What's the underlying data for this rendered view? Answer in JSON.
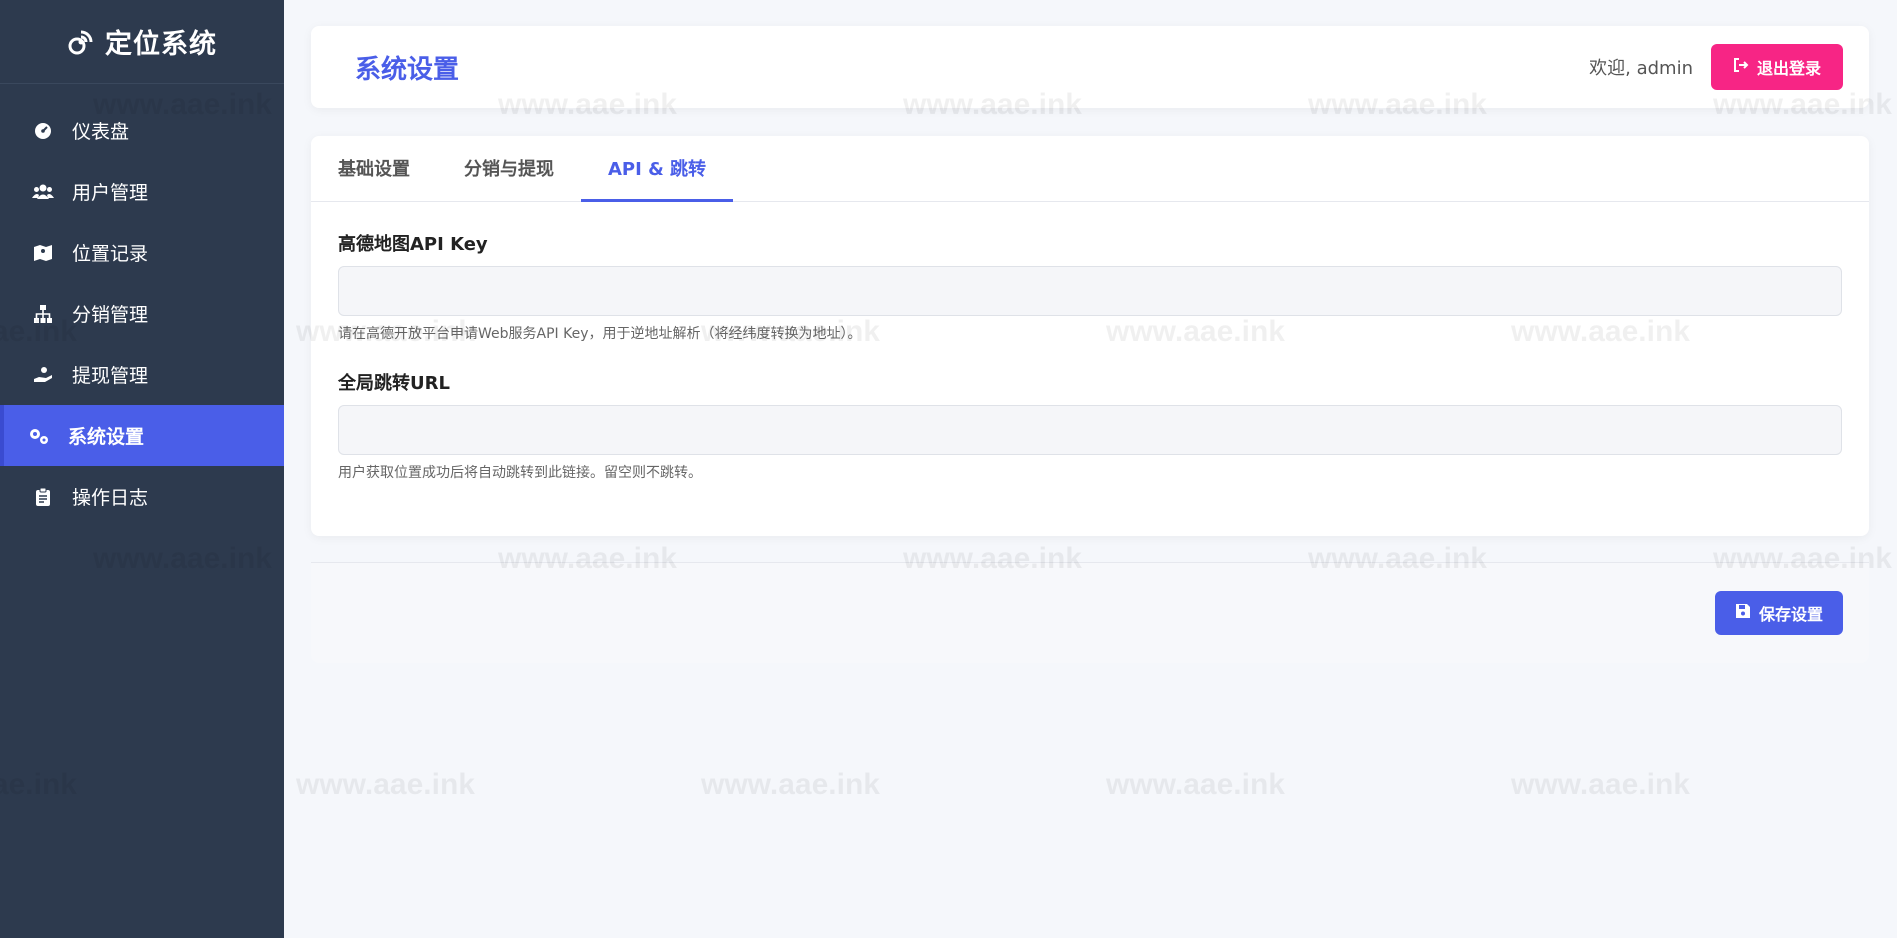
{
  "app": {
    "brand_title": "定位系统"
  },
  "sidebar": {
    "items": [
      {
        "label": "仪表盘",
        "icon": "dashboard-icon"
      },
      {
        "label": "用户管理",
        "icon": "users-icon"
      },
      {
        "label": "位置记录",
        "icon": "map-icon"
      },
      {
        "label": "分销管理",
        "icon": "sitemap-icon"
      },
      {
        "label": "提现管理",
        "icon": "hand-coin-icon"
      },
      {
        "label": "系统设置",
        "icon": "cogs-icon",
        "active": true
      },
      {
        "label": "操作日志",
        "icon": "clipboard-icon"
      }
    ]
  },
  "header": {
    "title": "系统设置",
    "welcome": "欢迎, admin",
    "logout_label": "退出登录"
  },
  "tabs": [
    {
      "label": "基础设置"
    },
    {
      "label": "分销与提现"
    },
    {
      "label": "API & 跳转",
      "active": true
    }
  ],
  "form": {
    "amap_key": {
      "label": "高德地图API Key",
      "value": "",
      "help": "请在高德开放平台申请Web服务API Key，用于逆地址解析（将经纬度转换为地址）。"
    },
    "redirect_url": {
      "label": "全局跳转URL",
      "value": "",
      "help": "用户获取位置成功后将自动跳转到此链接。留空则不跳转。"
    }
  },
  "actions": {
    "save_label": "保存设置"
  },
  "watermark": "www.aae.ink",
  "colors": {
    "sidebar_bg": "#2d3a4e",
    "accent": "#4a5ee8",
    "logout": "#f72585"
  }
}
